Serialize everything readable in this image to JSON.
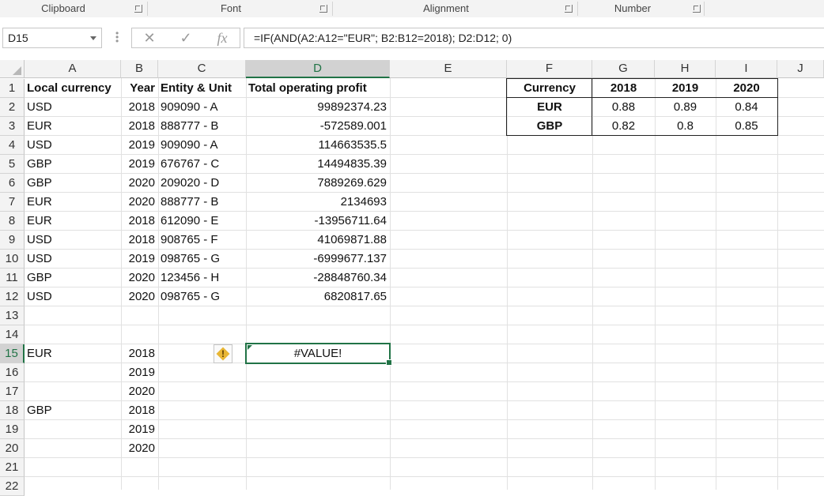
{
  "ribbon": {
    "groups": [
      "Clipboard",
      "Font",
      "Alignment",
      "Number"
    ]
  },
  "formula_bar": {
    "name_box": "D15",
    "cancel_icon": "✕",
    "enter_icon": "✓",
    "fx_label": "fx",
    "formula": "=IF(AND(A2:A12=\"EUR\"; B2:B12=2018); D2:D12; 0)"
  },
  "columns": [
    "A",
    "B",
    "C",
    "D",
    "E",
    "F",
    "G",
    "H",
    "I",
    "J"
  ],
  "rows": [
    "1",
    "2",
    "3",
    "4",
    "5",
    "6",
    "7",
    "8",
    "9",
    "10",
    "11",
    "12",
    "13",
    "14",
    "15",
    "16",
    "17",
    "18",
    "19",
    "20",
    "21",
    "22"
  ],
  "sheet": {
    "header": {
      "a": "Local currency",
      "b": "Year",
      "c": "Entity & Unit",
      "d": "Total operating profit"
    },
    "data": [
      {
        "a": "USD",
        "b": "2018",
        "c": "909090 - A",
        "d": "99892374.23"
      },
      {
        "a": "EUR",
        "b": "2018",
        "c": "888777 - B",
        "d": "-572589.001"
      },
      {
        "a": "USD",
        "b": "2019",
        "c": "909090 - A",
        "d": "114663535.5"
      },
      {
        "a": "GBP",
        "b": "2019",
        "c": "676767 - C",
        "d": "14494835.39"
      },
      {
        "a": "GBP",
        "b": "2020",
        "c": "209020 - D",
        "d": "7889269.629"
      },
      {
        "a": "EUR",
        "b": "2020",
        "c": "888777 - B",
        "d": "2134693"
      },
      {
        "a": "EUR",
        "b": "2018",
        "c": "612090 - E",
        "d": "-13956711.64"
      },
      {
        "a": "USD",
        "b": "2018",
        "c": "908765 - F",
        "d": "41069871.88"
      },
      {
        "a": "USD",
        "b": "2019",
        "c": "098765 - G",
        "d": "-6999677.137"
      },
      {
        "a": "GBP",
        "b": "2020",
        "c": "123456 - H",
        "d": "-28848760.34"
      },
      {
        "a": "USD",
        "b": "2020",
        "c": "098765 - G",
        "d": "6820817.65"
      }
    ],
    "summary": [
      {
        "a": "EUR",
        "b": "2018",
        "d": "#VALUE!"
      },
      {
        "a": "",
        "b": "2019",
        "d": ""
      },
      {
        "a": "",
        "b": "2020",
        "d": ""
      },
      {
        "a": "GBP",
        "b": "2018",
        "d": ""
      },
      {
        "a": "",
        "b": "2019",
        "d": ""
      },
      {
        "a": "",
        "b": "2020",
        "d": ""
      }
    ],
    "error_icon": "!"
  },
  "rates_table": {
    "header": [
      "Currency",
      "2018",
      "2019",
      "2020"
    ],
    "rows": [
      [
        "EUR",
        "0.88",
        "0.89",
        "0.84"
      ],
      [
        "GBP",
        "0.82",
        "0.8",
        "0.85"
      ]
    ]
  },
  "colors": {
    "accent": "#217346",
    "error_badge": "#e8b634"
  }
}
